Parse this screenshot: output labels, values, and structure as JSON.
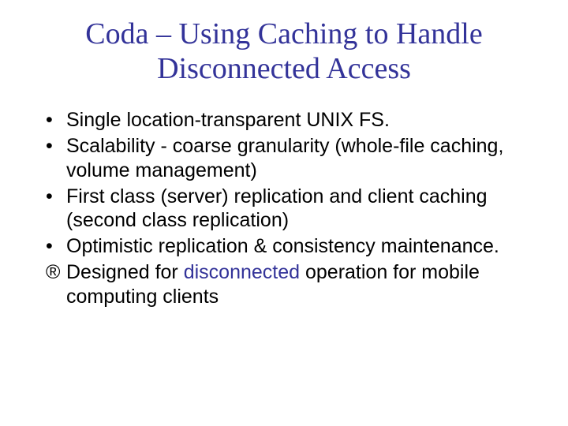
{
  "title": "Coda – Using Caching to Handle Disconnected Access",
  "bullets": {
    "b0": {
      "mark": "•",
      "text": "Single location-transparent UNIX FS."
    },
    "b1": {
      "mark": "•",
      "text": "Scalability - coarse granularity (whole-file caching, volume management)"
    },
    "b2": {
      "mark": "•",
      "text": "First class (server) replication and client caching (second class replication)"
    },
    "b3": {
      "mark": "•",
      "text": "Optimistic replication & consistency maintenance."
    },
    "b4": {
      "mark": "®",
      "pre": "Designed for ",
      "hl": "disconnected",
      "post": " operation for mobile computing clients"
    }
  }
}
